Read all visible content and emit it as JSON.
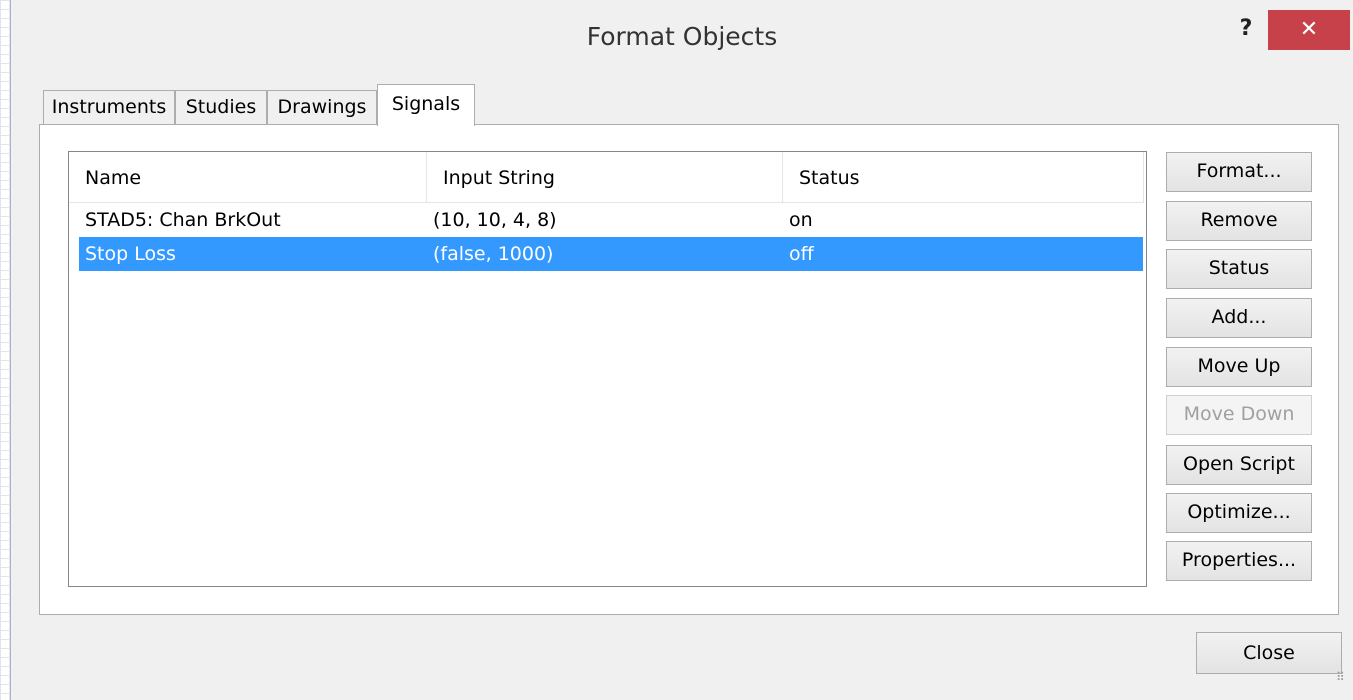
{
  "window": {
    "title": "Format Objects",
    "help_label": "?",
    "close_label": "✕"
  },
  "tabs": [
    {
      "label": "Instruments"
    },
    {
      "label": "Studies"
    },
    {
      "label": "Drawings"
    },
    {
      "label": "Signals"
    }
  ],
  "active_tab": "Signals",
  "table": {
    "columns": [
      "Name",
      "Input String",
      "Status"
    ],
    "rows": [
      {
        "name": "STAD5: Chan BrkOut",
        "input": "(10,  10,  4,  8)",
        "status": "on"
      },
      {
        "name": "Stop Loss",
        "input": "(false,  1000)",
        "status": "off"
      }
    ],
    "selected_row": "Stop Loss"
  },
  "buttons": {
    "format": "Format...",
    "remove": "Remove",
    "status": "Status",
    "add": "Add...",
    "move_up": "Move Up",
    "move_down": "Move Down",
    "open_script": "Open Script",
    "optimize": "Optimize...",
    "properties": "Properties...",
    "close": "Close"
  },
  "colors": {
    "selection": "#3399ff",
    "close_x_bg": "#c7414a"
  }
}
